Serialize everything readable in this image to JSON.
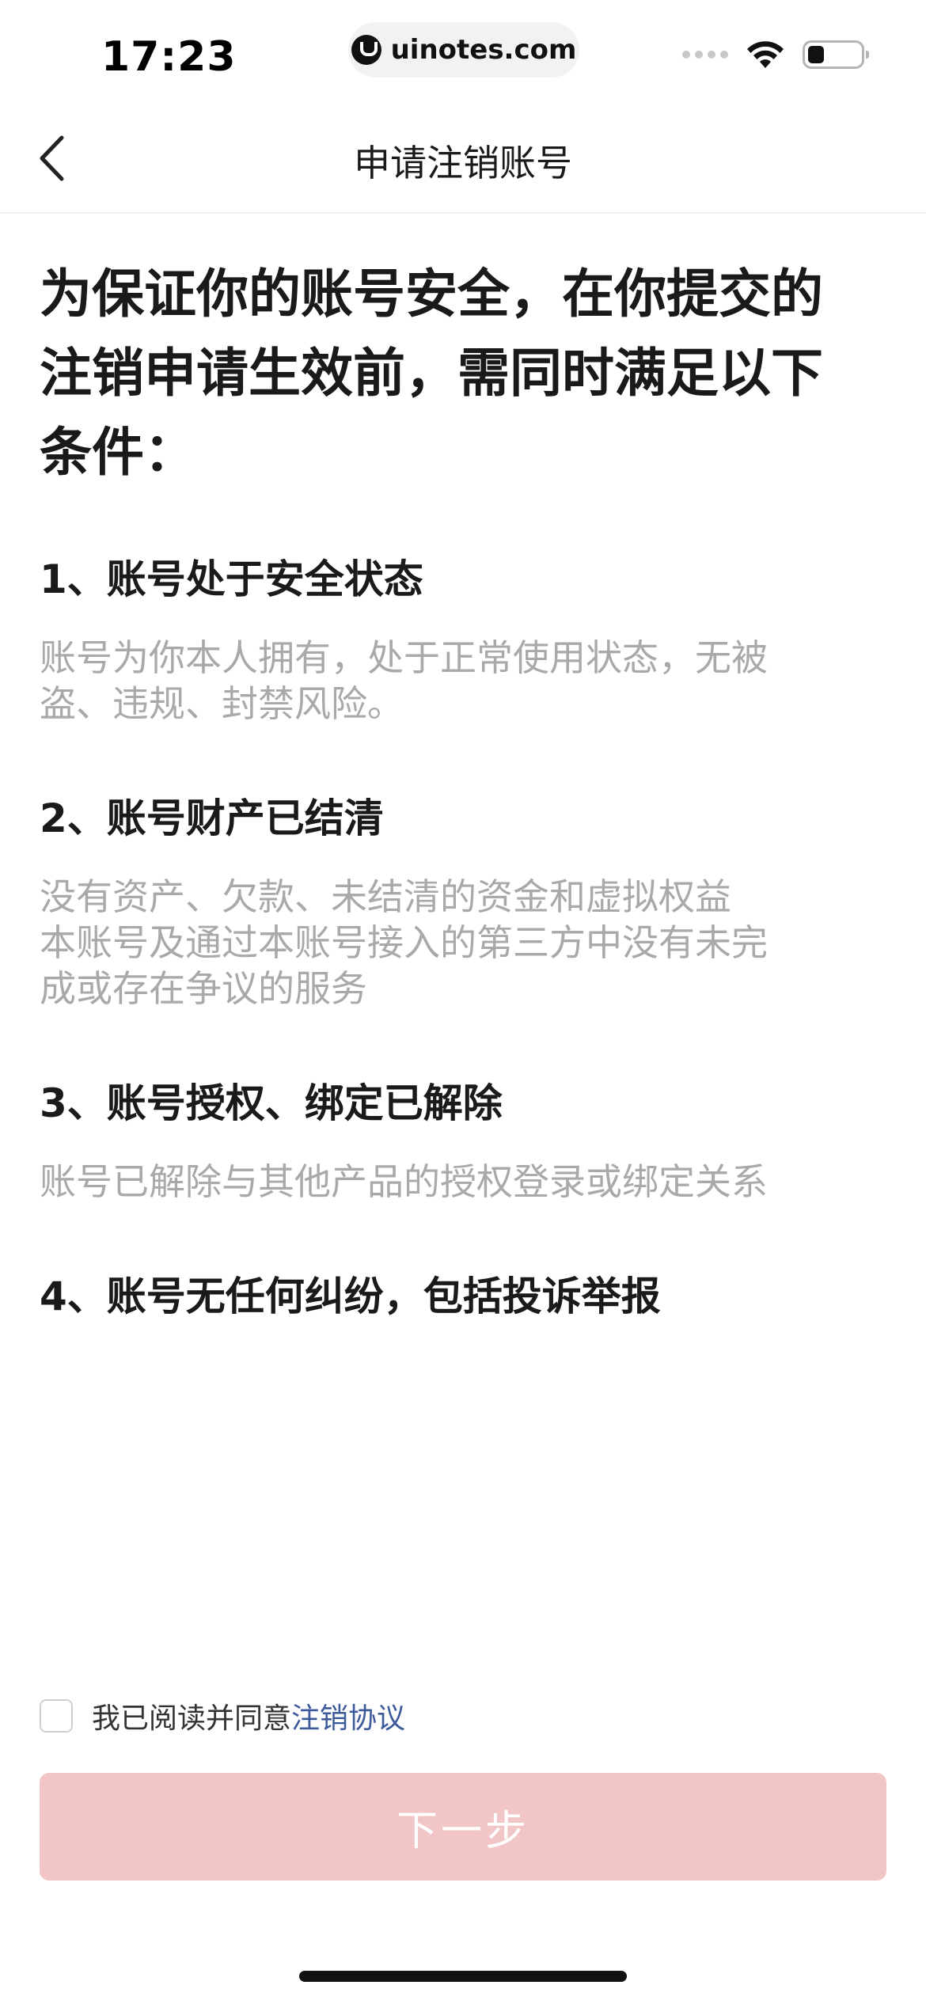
{
  "status_bar": {
    "time": "17:23",
    "url": "uinotes.com"
  },
  "nav": {
    "title": "申请注销账号"
  },
  "intro": {
    "lines": [
      "为保证你的账号安全，在你提交的",
      "注销申请生效前，需同时满足以下",
      "条件："
    ]
  },
  "conditions": [
    {
      "title": "1、账号处于安全状态",
      "desc_lines": [
        "账号为你本人拥有，处于正常使用状态，无被",
        "盗、违规、封禁风险。"
      ]
    },
    {
      "title": "2、账号财产已结清",
      "desc_lines": [
        "没有资产、欠款、未结清的资金和虚拟权益",
        "本账号及通过本账号接入的第三方中没有未完",
        "成或存在争议的服务"
      ]
    },
    {
      "title": "3、账号授权、绑定已解除",
      "desc_lines": [
        "账号已解除与其他产品的授权登录或绑定关系"
      ]
    },
    {
      "title": "4、账号无任何纠纷，包括投诉举报",
      "desc_lines": []
    }
  ],
  "agreement": {
    "prefix": "我已阅读并同意",
    "link": "注销协议",
    "checked": false
  },
  "next_button": {
    "label": "下一步",
    "enabled": false
  },
  "colors": {
    "button_disabled": "#f2c6c6",
    "link": "#3c5a9a",
    "desc_text": "#a9a9a9"
  }
}
